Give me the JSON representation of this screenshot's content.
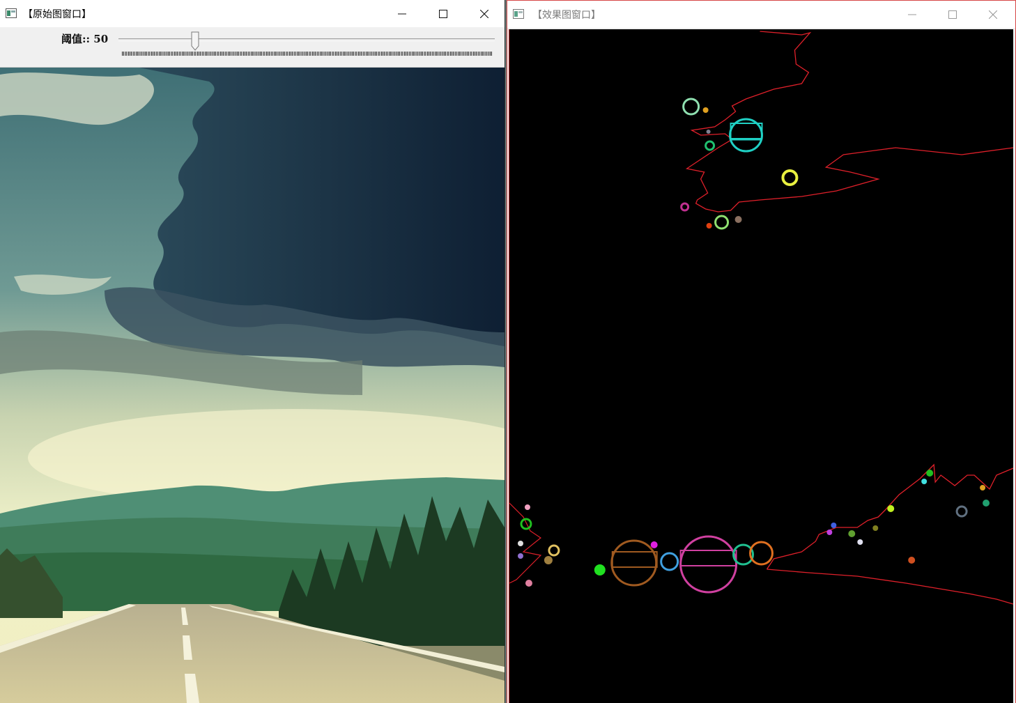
{
  "left_window": {
    "title": "【原始图窗口】",
    "trackbar": {
      "label": "阈值:: 50",
      "value": 50
    },
    "image": {
      "content": "photo-road-mountains-clouds"
    }
  },
  "right_window": {
    "title": "【效果图窗口】",
    "canvas": {
      "background": "#000000",
      "contour_color": "#e0202a"
    }
  },
  "window_controls": {
    "minimize": "minimize-icon",
    "maximize": "maximize-icon",
    "close": "close-icon"
  }
}
